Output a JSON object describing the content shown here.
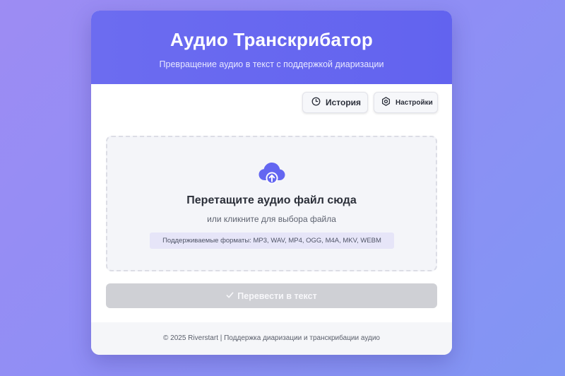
{
  "header": {
    "title": "Аудио Транскрибатор",
    "subtitle": "Превращение аудио в текст с поддержкой диаризации"
  },
  "toolbar": {
    "history_label": "История",
    "history_icon": "clock-icon",
    "settings_label": "Настройки",
    "settings_icon": "gear-icon"
  },
  "dropzone": {
    "icon": "cloud-upload-icon",
    "title": "Перетащите аудио файл сюда",
    "subtitle": "или кликните для выбора файла",
    "formats": "Поддерживаемые форматы: MP3, WAV, MP4, OGG, M4A, MKV, WEBM"
  },
  "convert": {
    "label": "Перевести в текст",
    "icon": "check-icon",
    "state": "disabled"
  },
  "footer": {
    "text": "© 2025 Riverstart | Поддержка диаризации и транскрибации аудио"
  },
  "colors": {
    "accent": "#6366f1",
    "background_start": "#9d8cf3",
    "background_end": "#8196f3",
    "disabled_button": "#cfd0d5"
  }
}
